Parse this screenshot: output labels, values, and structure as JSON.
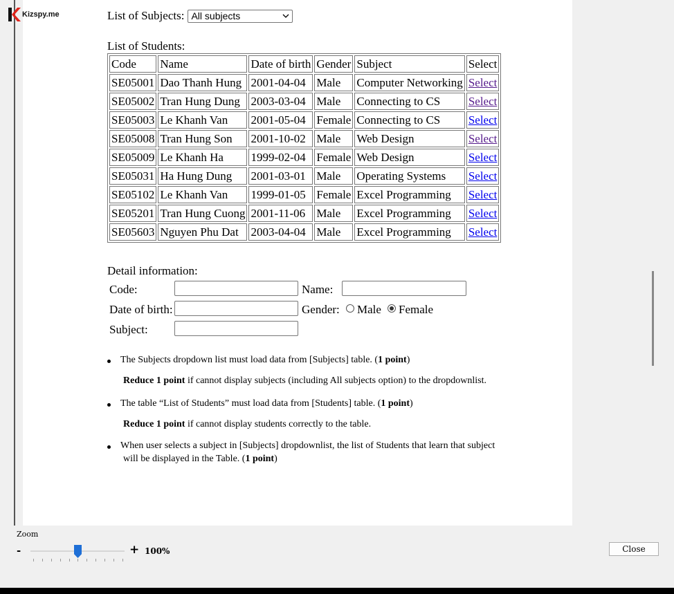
{
  "logo": {
    "text": "Kizspy.me"
  },
  "form": {
    "subjects_label": "List of Subjects:",
    "subjects_selected": "All subjects",
    "students_label": "List of Students:",
    "columns": [
      "Code",
      "Name",
      "Date of birth",
      "Gender",
      "Subject",
      "Select"
    ],
    "rows": [
      [
        "SE05001",
        "Dao Thanh Hung",
        "2001-04-04",
        "Male",
        "Computer Networking",
        "Select"
      ],
      [
        "SE05002",
        "Tran Hung Dung",
        "2003-03-04",
        "Male",
        "Connecting to CS",
        "Select"
      ],
      [
        "SE05003",
        "Le Khanh Van",
        "2001-05-04",
        "Female",
        "Connecting to CS",
        "Select"
      ],
      [
        "SE05008",
        "Tran Hung Son",
        "2001-10-02",
        "Male",
        "Web Design",
        "Select"
      ],
      [
        "SE05009",
        "Le Khanh Ha",
        "1999-02-04",
        "Female",
        "Web Design",
        "Select"
      ],
      [
        "SE05031",
        "Ha Hung Dung",
        "2001-03-01",
        "Male",
        "Operating Systems",
        "Select"
      ],
      [
        "SE05102",
        "Le Khanh Van",
        "1999-01-05",
        "Female",
        "Excel Programming",
        "Select"
      ],
      [
        "SE05201",
        "Tran Hung Cuong",
        "2001-11-06",
        "Male",
        "Excel Programming",
        "Select"
      ],
      [
        "SE05603",
        "Nguyen Phu Dat",
        "2003-04-04",
        "Male",
        "Excel Programming",
        "Select"
      ]
    ],
    "detail_label": "Detail information:",
    "code_label": "Code:",
    "name_label": "Name:",
    "dob_label": "Date of birth:",
    "gender_label": "Gender:",
    "male_label": "Male",
    "female_label": "Female",
    "gender_selected": "Female",
    "subject_label": "Subject:"
  },
  "requirements": {
    "r1": {
      "a": "The Subjects dropdown list must load data from [Subjects] table. (",
      "b": "1 point",
      "c": ")"
    },
    "r1_note": {
      "b": "Reduce 1 point",
      "c": " if cannot display subjects (including All subjects option) to the dropdownlist."
    },
    "r2": {
      "a": "The table “List of Students” must load data from [Students] table. (",
      "b": "1 point",
      "c": ")"
    },
    "r2_note": {
      "b": "Reduce 1 point",
      "c": " if cannot display students correctly to the table."
    },
    "r3": {
      "a": "When user selects a subject in [Subjects] dropdownlist, the list of Students that learn that subject"
    },
    "r3_cont": {
      "a": "will be displayed in the Table. (",
      "b": "1 point",
      "c": ")"
    }
  },
  "zoom": {
    "title": "Zoom",
    "minus": "-",
    "plus": "+",
    "value": "100%",
    "level_percent": 100
  },
  "close_label": "Close"
}
